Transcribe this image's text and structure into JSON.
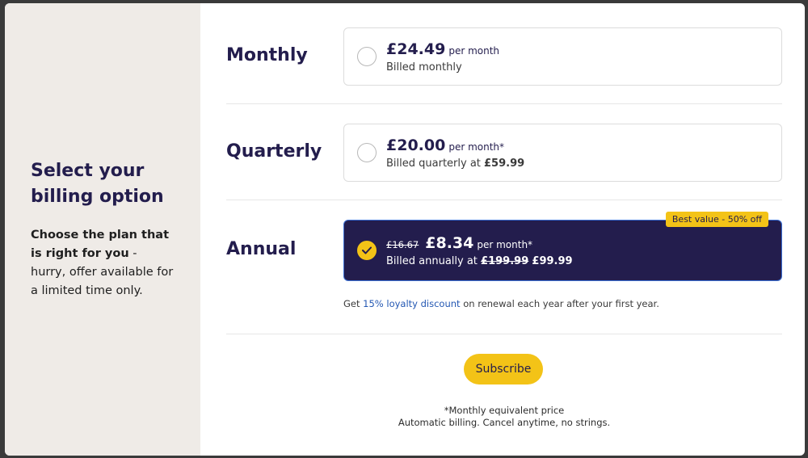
{
  "sidebar": {
    "title": "Select your billing option",
    "desc_bold": "Choose the plan that is right for you",
    "desc_rest": " - hurry, offer available for a limited time only."
  },
  "plans": [
    {
      "label": "Monthly",
      "price": "£24.49",
      "per": "per month",
      "billing": "Billed monthly",
      "selected": false
    },
    {
      "label": "Quarterly",
      "price": "£20.00",
      "per": "per month*",
      "billing_prefix": "Billed quarterly at ",
      "billing_amount": "£59.99",
      "selected": false
    },
    {
      "label": "Annual",
      "old_price": "£16.67",
      "price": "£8.34",
      "per": "per month*",
      "billing_prefix": "Billed annually at ",
      "billing_old": "£199.99",
      "billing_amount": "£99.99",
      "badge": "Best value - 50% off",
      "selected": true
    }
  ],
  "loyalty": {
    "prefix": "Get ",
    "link": "15% loyalty discount",
    "suffix": " on renewal each year after your first year."
  },
  "subscribe_label": "Subscribe",
  "footnote_1": "*Monthly equivalent price",
  "footnote_2": "Automatic billing. Cancel anytime, no strings.",
  "colors": {
    "navy": "#231d4d",
    "accent_yellow": "#f3c317",
    "link_blue": "#2458b3",
    "sidebar_bg": "#efebe7"
  }
}
